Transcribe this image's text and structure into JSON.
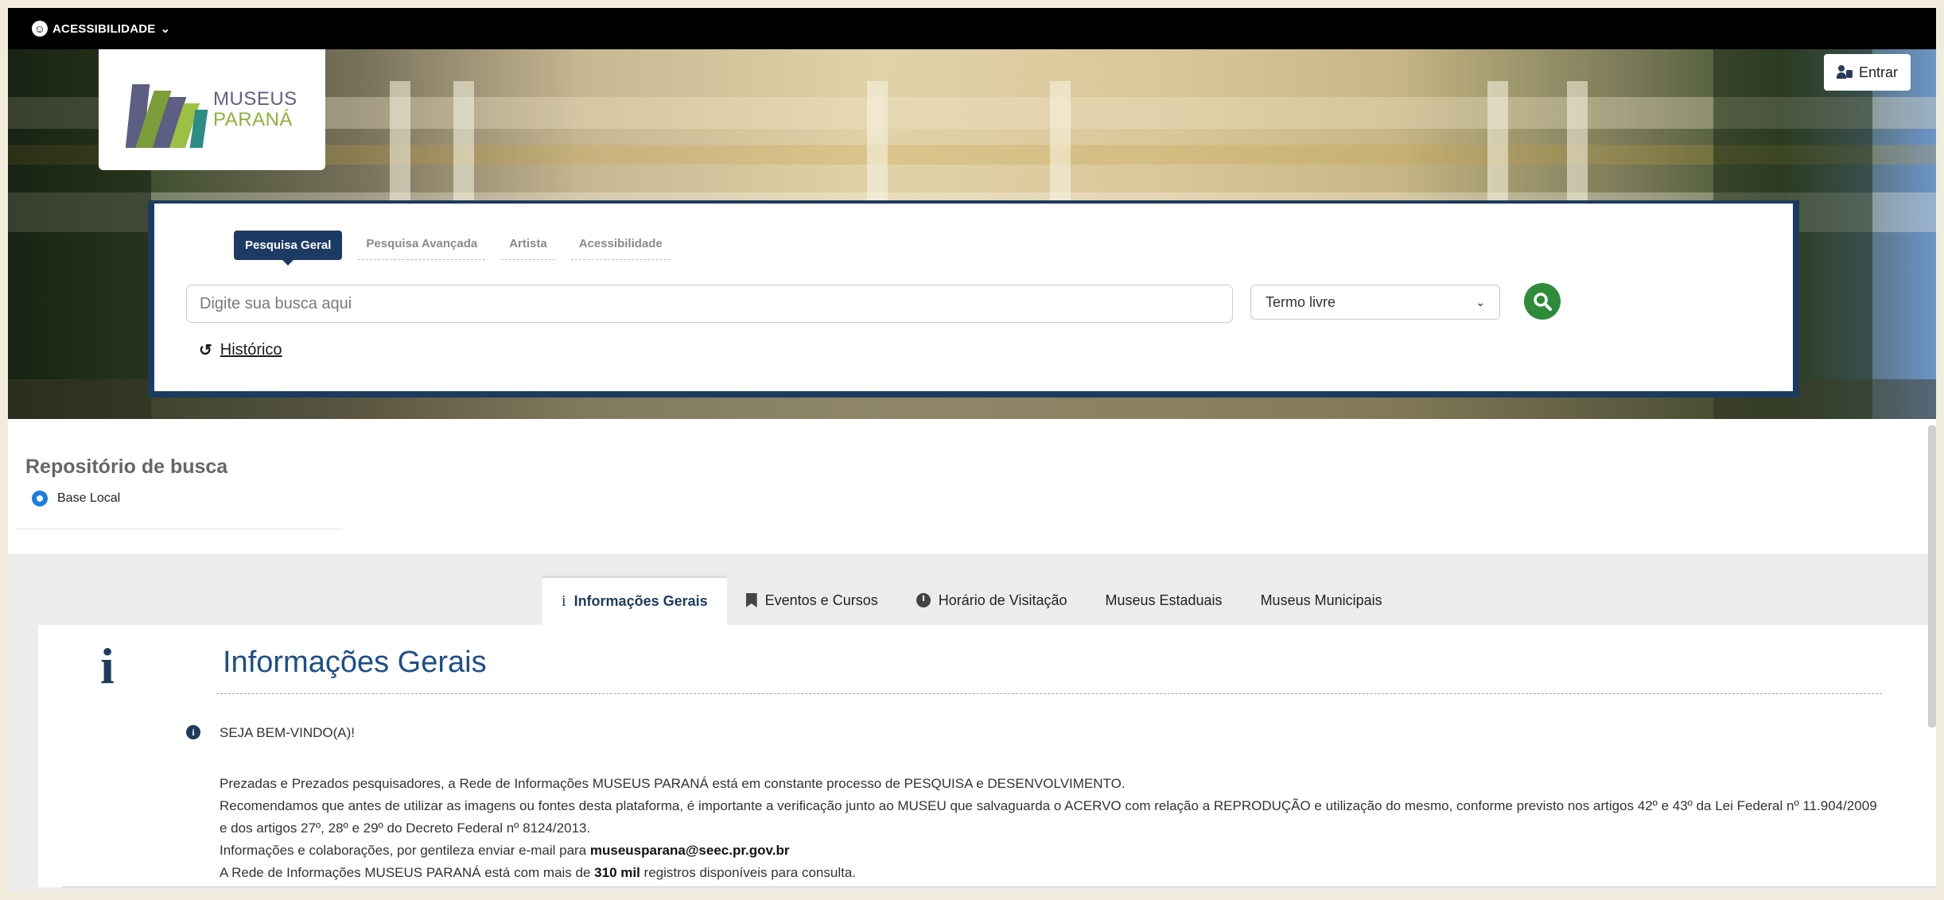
{
  "topbar": {
    "accessibility_label": "ACESSIBILIDADE"
  },
  "logo": {
    "line1": "MUSEUS",
    "line2": "PARANÁ"
  },
  "login": {
    "label": "Entrar"
  },
  "search": {
    "tabs": [
      "Pesquisa Geral",
      "Pesquisa Avançada",
      "Artista",
      "Acessibilidade"
    ],
    "active_tab": 0,
    "placeholder": "Digite sua busca aqui",
    "value": "",
    "select_value": "Termo livre",
    "history_label": "Histórico"
  },
  "repository": {
    "title": "Repositório de busca",
    "option": "Base Local"
  },
  "info_tabs": [
    "Informações Gerais",
    "Eventos e Cursos",
    "Horário de Visitação",
    "Museus Estaduais",
    "Museus Municipais"
  ],
  "content": {
    "title": "Informações Gerais",
    "welcome": "SEJA BEM-VINDO(A)!",
    "para1": "Prezadas e Prezados pesquisadores, a Rede de Informações MUSEUS PARANÁ está em constante processo de PESQUISA e DESENVOLVIMENTO.",
    "para2": "Recomendamos que antes de utilizar as imagens ou fontes desta plataforma, é importante a verificação junto ao MUSEU  que salvaguarda o ACERVO com relação a REPRODUÇÃO e utilização do mesmo, conforme previsto nos artigos 42º e 43º da Lei Federal nº 11.904/2009 e dos artigos 27º, 28º e 29º do Decreto Federal nº 8124/2013.",
    "para3_prefix": "Informações e colaborações, por gentileza enviar e-mail para ",
    "para3_email": "museusparana@seec.pr.gov.br",
    "para4_prefix": "A Rede de Informações MUSEUS PARANÁ está com mais de ",
    "para4_bold": "310 mil",
    "para4_suffix": " registros disponíveis para consulta."
  },
  "colors": {
    "navy": "#1d3b5e",
    "green": "#2e8b3a",
    "radio": "#1a7ee0"
  }
}
